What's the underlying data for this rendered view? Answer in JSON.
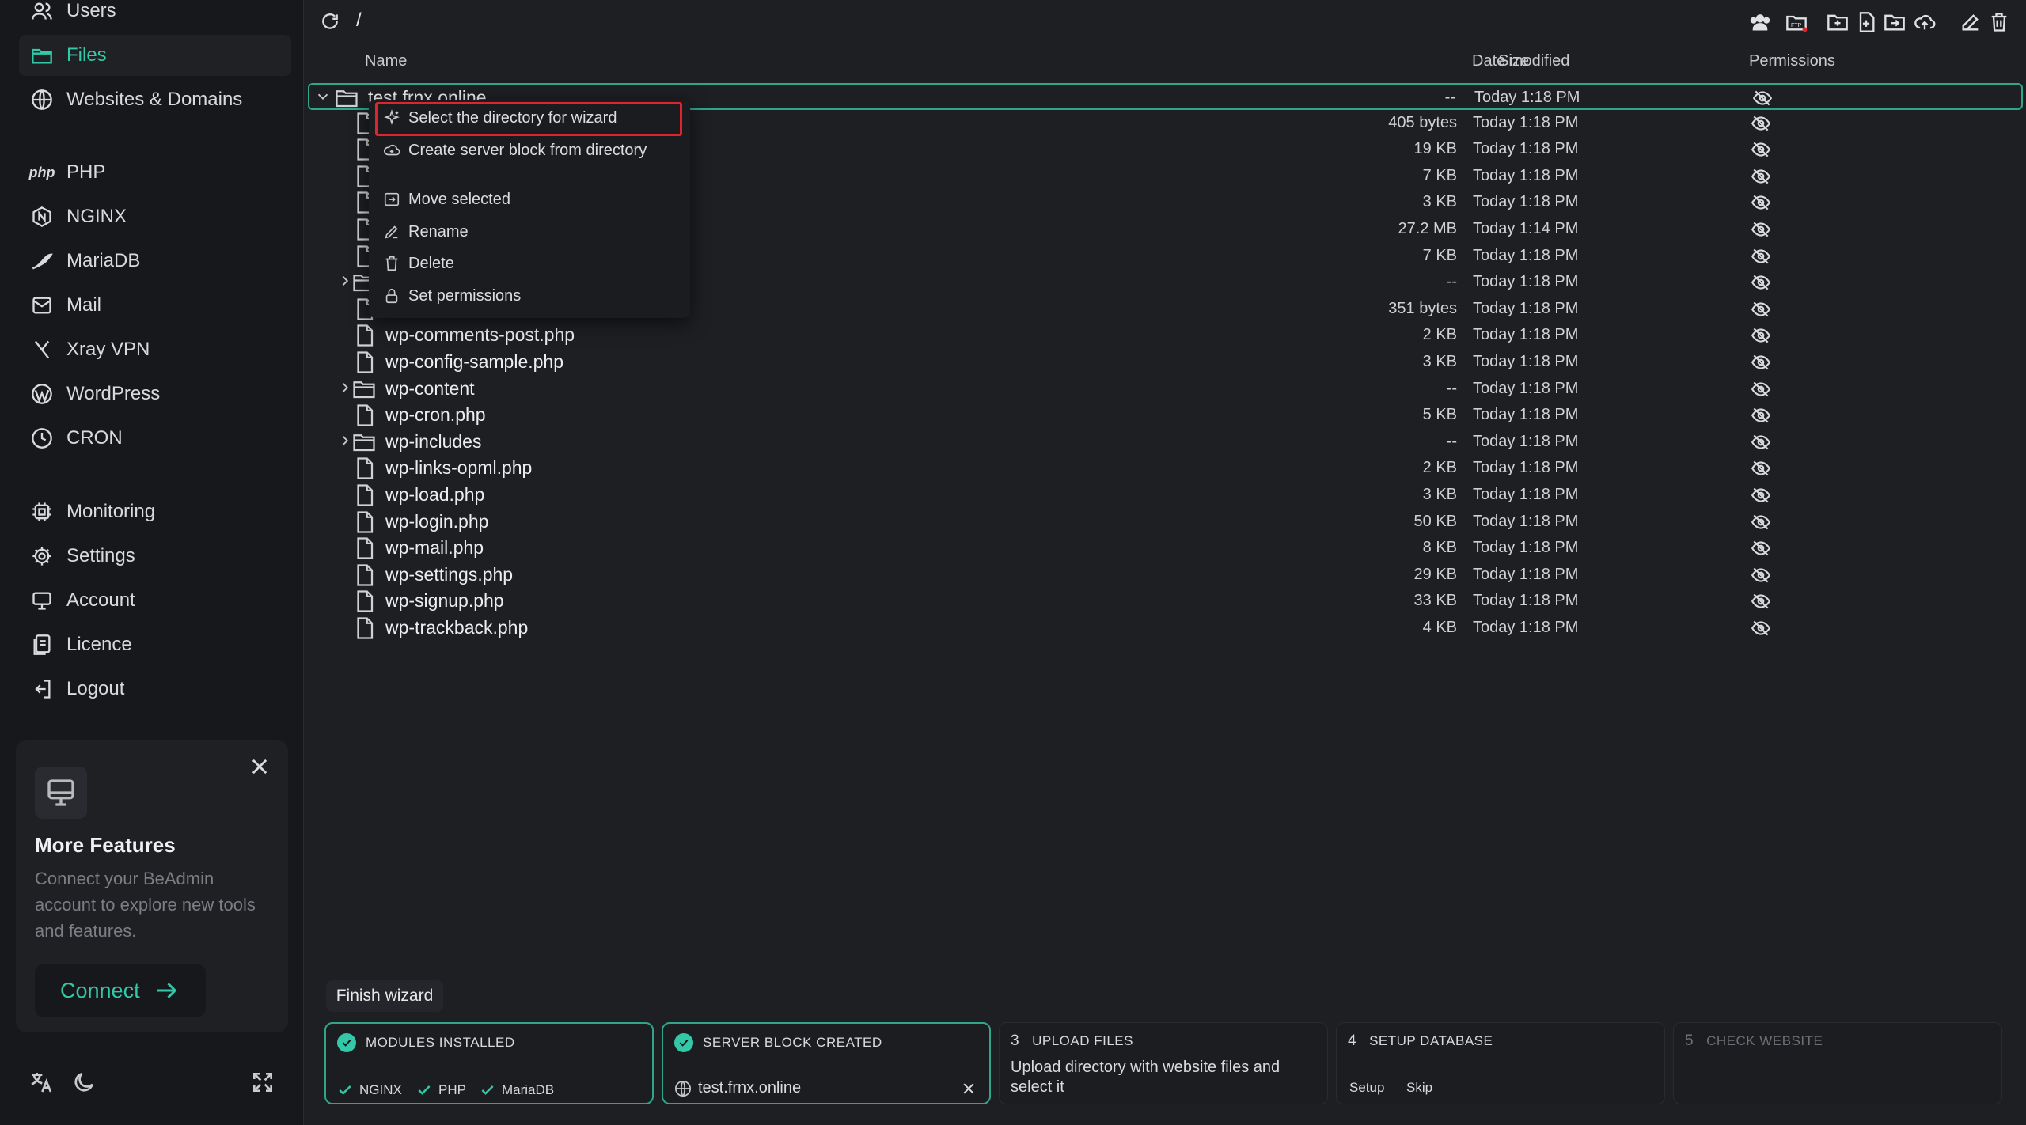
{
  "sidebar": {
    "items": [
      {
        "label": "Users",
        "icon": "users-icon"
      },
      {
        "label": "Files",
        "icon": "folder-icon",
        "active": true
      },
      {
        "label": "Websites & Domains",
        "icon": "globe-icon"
      },
      {
        "label": "PHP",
        "icon": "php-icon"
      },
      {
        "label": "NGINX",
        "icon": "nginx-icon"
      },
      {
        "label": "MariaDB",
        "icon": "mariadb-icon"
      },
      {
        "label": "Mail",
        "icon": "mail-icon"
      },
      {
        "label": "Xray VPN",
        "icon": "xray-icon"
      },
      {
        "label": "WordPress",
        "icon": "wordpress-icon"
      },
      {
        "label": "CRON",
        "icon": "clock-icon"
      },
      {
        "label": "Monitoring",
        "icon": "chip-icon"
      },
      {
        "label": "Settings",
        "icon": "gear-icon"
      },
      {
        "label": "Account",
        "icon": "monitor-icon"
      },
      {
        "label": "Licence",
        "icon": "license-icon"
      },
      {
        "label": "Logout",
        "icon": "logout-icon"
      }
    ],
    "promo": {
      "title": "More Features",
      "description": "Connect your BeAdmin account to explore new tools and features.",
      "button": "Connect"
    },
    "php_glyph": "php"
  },
  "topbar": {
    "path": "/"
  },
  "columns": {
    "name": "Name",
    "size": "Size",
    "date": "Date modified",
    "permissions": "Permissions"
  },
  "rows": [
    {
      "name": "test.frnx.online",
      "size": "--",
      "date": "Today 1:18 PM"
    },
    {
      "name": "",
      "size": "405 bytes",
      "date": "Today 1:18 PM"
    },
    {
      "name": "",
      "size": "19 KB",
      "date": "Today 1:18 PM"
    },
    {
      "name": "",
      "size": "7 KB",
      "date": "Today 1:18 PM"
    },
    {
      "name": "",
      "size": "3 KB",
      "date": "Today 1:18 PM"
    },
    {
      "name": "",
      "size": "27.2 MB",
      "date": "Today 1:14 PM"
    },
    {
      "name": "",
      "size": "7 KB",
      "date": "Today 1:18 PM"
    },
    {
      "name": "",
      "size": "--",
      "date": "Today 1:18 PM"
    },
    {
      "name": "",
      "size": "351 bytes",
      "date": "Today 1:18 PM"
    },
    {
      "name": "wp-comments-post.php",
      "size": "2 KB",
      "date": "Today 1:18 PM"
    },
    {
      "name": "wp-config-sample.php",
      "size": "3 KB",
      "date": "Today 1:18 PM"
    },
    {
      "name": "wp-content",
      "size": "--",
      "date": "Today 1:18 PM"
    },
    {
      "name": "wp-cron.php",
      "size": "5 KB",
      "date": "Today 1:18 PM"
    },
    {
      "name": "wp-includes",
      "size": "--",
      "date": "Today 1:18 PM"
    },
    {
      "name": "wp-links-opml.php",
      "size": "2 KB",
      "date": "Today 1:18 PM"
    },
    {
      "name": "wp-load.php",
      "size": "3 KB",
      "date": "Today 1:18 PM"
    },
    {
      "name": "wp-login.php",
      "size": "50 KB",
      "date": "Today 1:18 PM"
    },
    {
      "name": "wp-mail.php",
      "size": "8 KB",
      "date": "Today 1:18 PM"
    },
    {
      "name": "wp-settings.php",
      "size": "29 KB",
      "date": "Today 1:18 PM"
    },
    {
      "name": "wp-signup.php",
      "size": "33 KB",
      "date": "Today 1:18 PM"
    },
    {
      "name": "wp-trackback.php",
      "size": "4 KB",
      "date": "Today 1:18 PM"
    }
  ],
  "context_menu": {
    "items": [
      "Select the directory for wizard",
      "Create server block from directory",
      "Move selected",
      "Rename",
      "Delete",
      "Set permissions"
    ]
  },
  "wizard": {
    "finish": "Finish wizard",
    "steps": [
      {
        "title": "MODULES INSTALLED",
        "modules": [
          "NGINX",
          "PHP",
          "MariaDB"
        ]
      },
      {
        "title": "SERVER BLOCK CREATED",
        "domain": "test.frnx.online"
      },
      {
        "number": "3",
        "title": "UPLOAD FILES",
        "body": "Upload directory with website files and select it"
      },
      {
        "number": "4",
        "title": "SETUP DATABASE",
        "actions": [
          "Setup",
          "Skip"
        ]
      },
      {
        "number": "5",
        "title": "CHECK WEBSITE"
      }
    ]
  },
  "colors": {
    "accent": "#33c9a8",
    "highlight": "#e0242b",
    "background": "#1e1f23",
    "sidebar": "#17181b"
  }
}
